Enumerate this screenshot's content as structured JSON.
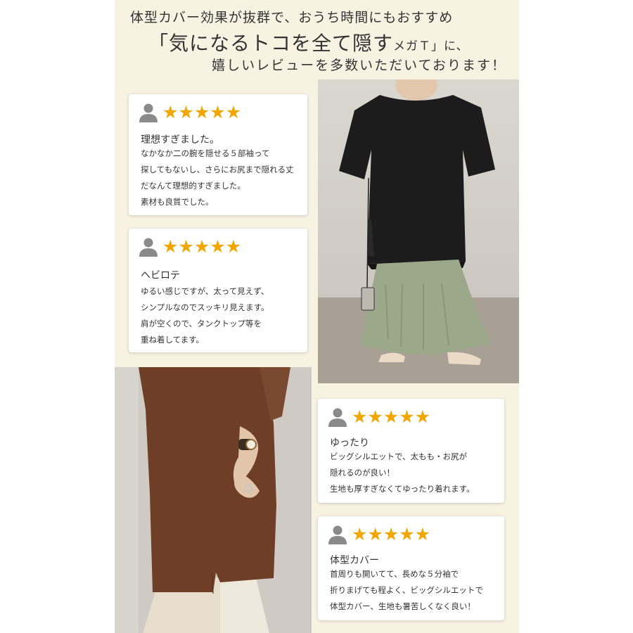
{
  "headline": {
    "line1": "体型カバー効果が抜群で、おうち時間にもおすすめ",
    "line2_main": "「気になるトコを全て隠す",
    "line2_small": "メガＴ」に、",
    "line3": "嬉しいレビューを多数いただいております！"
  },
  "reviews": [
    {
      "stars": "★★★★★",
      "rating": 5,
      "title": "理想すぎました。",
      "lines": [
        "なかなか二の腕を隠せる５部袖って",
        "探してもないし、さらにお尻まで隠れる丈",
        "だなんて理想的すぎました。",
        "素材も良質でした。"
      ]
    },
    {
      "stars": "★★★★★",
      "rating": 5,
      "title": "ヘビロテ",
      "lines": [
        "ゆるい感じですが、太って見えず、",
        "シンプルなのでスッキリ見えます。",
        "肩が空くので、タンクトップ等を",
        "重ね着してます。"
      ]
    },
    {
      "stars": "★★★★★",
      "rating": 5,
      "title": "ゆったり",
      "lines": [
        "ビッグシルエットで、太もも・お尻が",
        "隠れるのが良い！",
        "生地も厚すぎなくてゆったり着れます。"
      ]
    },
    {
      "stars": "★★★★★",
      "rating": 5,
      "title": "体型カバー",
      "lines": [
        "首周りも開いてて、長めな５分袖で",
        "折りまげても程よく、ビッグシルエットで",
        "体型カバー、生地も暑苦しくなく良い！"
      ]
    }
  ],
  "colors": {
    "panel_bg": "#f8f2e3",
    "star": "#f2a600",
    "user_icon": "#8a8a8a",
    "tee_black": "#1c1c1c",
    "tee_brown": "#6e3f26",
    "skirt_green": "#9ca88a"
  },
  "icons": [
    "user-icon",
    "star-icon"
  ]
}
